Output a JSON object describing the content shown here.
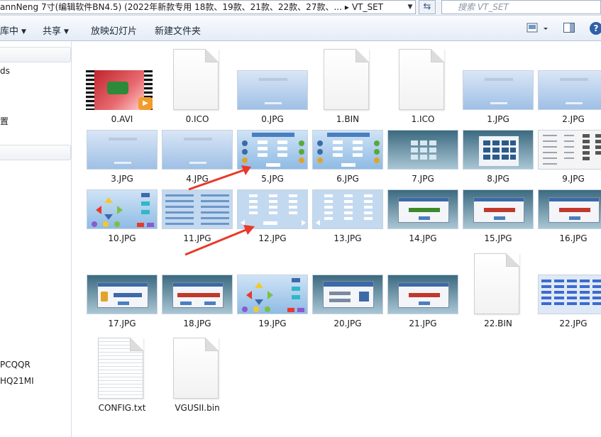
{
  "address": {
    "path_text": "annNeng 7寸(编辑软件BN4.5) (2022年新款专用 18款、19款、21款、22款、27款、...",
    "current_folder": "VT_SET",
    "search_placeholder": "搜索 VT_SET"
  },
  "toolbar": {
    "include": "库中",
    "share": "共享",
    "slideshow": "放映幻灯片",
    "new_folder": "新建文件夹",
    "help": "?"
  },
  "nav": {
    "items": [
      "ds",
      "置",
      "PCQQR",
      "HQ21MI"
    ]
  },
  "files": [
    {
      "name": "0.AVI",
      "kind": "video"
    },
    {
      "name": "0.ICO",
      "kind": "blank"
    },
    {
      "name": "0.JPG",
      "kind": "splash"
    },
    {
      "name": "1.BIN",
      "kind": "blank"
    },
    {
      "name": "1.ICO",
      "kind": "blank"
    },
    {
      "name": "1.JPG",
      "kind": "splash"
    },
    {
      "name": "2.JPG",
      "kind": "splash"
    },
    {
      "name": "3.JPG",
      "kind": "splash"
    },
    {
      "name": "4.JPG",
      "kind": "splash"
    },
    {
      "name": "5.JPG",
      "kind": "panel"
    },
    {
      "name": "6.JPG",
      "kind": "panel"
    },
    {
      "name": "7.JPG",
      "kind": "keypad"
    },
    {
      "name": "8.JPG",
      "kind": "keypad"
    },
    {
      "name": "9.JPG",
      "kind": "table"
    },
    {
      "name": "10.JPG",
      "kind": "arrows"
    },
    {
      "name": "11.JPG",
      "kind": "list"
    },
    {
      "name": "12.JPG",
      "kind": "bars"
    },
    {
      "name": "13.JPG",
      "kind": "bars"
    },
    {
      "name": "14.JPG",
      "kind": "dialog-green"
    },
    {
      "name": "15.JPG",
      "kind": "dialog-red"
    },
    {
      "name": "16.JPG",
      "kind": "dialog-red"
    },
    {
      "name": "17.JPG",
      "kind": "dialog-lock"
    },
    {
      "name": "18.JPG",
      "kind": "dialog-red"
    },
    {
      "name": "19.JPG",
      "kind": "arrows"
    },
    {
      "name": "20.JPG",
      "kind": "login"
    },
    {
      "name": "21.JPG",
      "kind": "dialog-red"
    },
    {
      "name": "22.BIN",
      "kind": "blank"
    },
    {
      "name": "22.JPG",
      "kind": "list"
    },
    {
      "name": "CONFIG.txt",
      "kind": "text"
    },
    {
      "name": "VGUSII.bin",
      "kind": "blank"
    }
  ],
  "colors": {
    "accent": "#3f78c0",
    "arrow": "#e8392a"
  }
}
